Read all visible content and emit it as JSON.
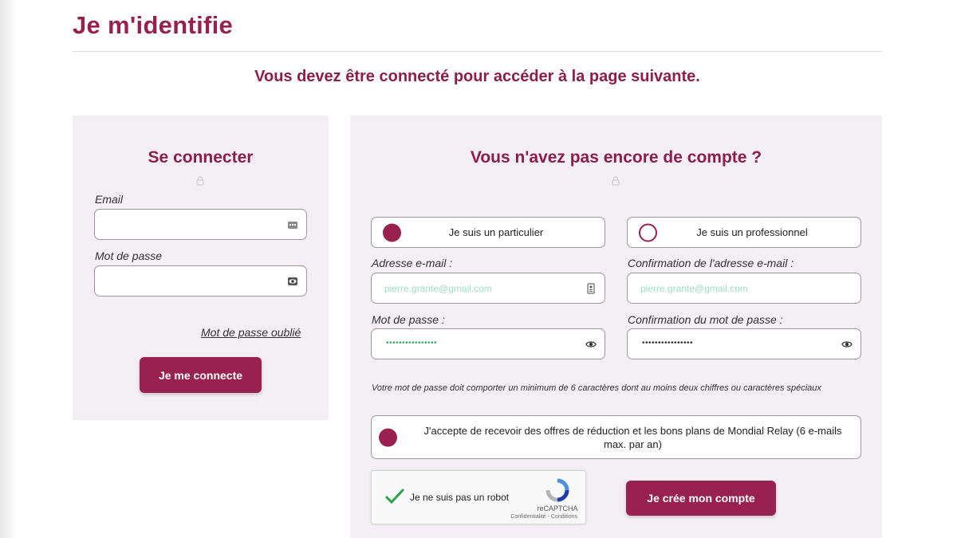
{
  "page": {
    "title": "Je m'identifie",
    "notice": "Vous devez être connecté pour accéder à la page suivante."
  },
  "login": {
    "title": "Se connecter",
    "email_label": "Email",
    "email_value": "",
    "email_icon": "autofill-card-icon",
    "password_label": "Mot de passe",
    "password_value": "",
    "password_icon": "eye-icon",
    "forgot_link": "Mot de passe oublié",
    "submit_label": "Je me connecte"
  },
  "register": {
    "title": "Vous n'avez pas encore de compte ?",
    "account_types": [
      {
        "label": "Je suis un particulier",
        "selected": true
      },
      {
        "label": "Je suis un professionnel",
        "selected": false
      }
    ],
    "email_label": "Adresse e-mail :",
    "email_value": "pierre.grante@gmail.com",
    "email_confirm_label": "Confirmation de l'adresse e-mail :",
    "email_confirm_value": "pierre.grante@gmail.com",
    "password_label": "Mot de passe :",
    "password_value": "••••••••••••••••",
    "password_confirm_label": "Confirmation du mot de passe :",
    "password_confirm_value": "••••••••••••••••",
    "password_hint": "Votre mot de passe doit comporter un minimum de 6 caractères dont au moins deux chiffres ou caractères spéciaux",
    "optin_label": "J'accepte de recevoir des offres de réduction et les bons plans de Mondial Relay (6 e-mails max. par an)",
    "optin_checked": true,
    "submit_label": "Je crée mon compte"
  },
  "captcha": {
    "label": "Je ne suis pas un robot",
    "checked": true,
    "brand": "reCAPTCHA",
    "links": "Confidentialité - Conditions"
  },
  "colors": {
    "brand": "#98214f",
    "panel_background": "#f3eff4",
    "autofill_text": "#9fdcc9"
  }
}
